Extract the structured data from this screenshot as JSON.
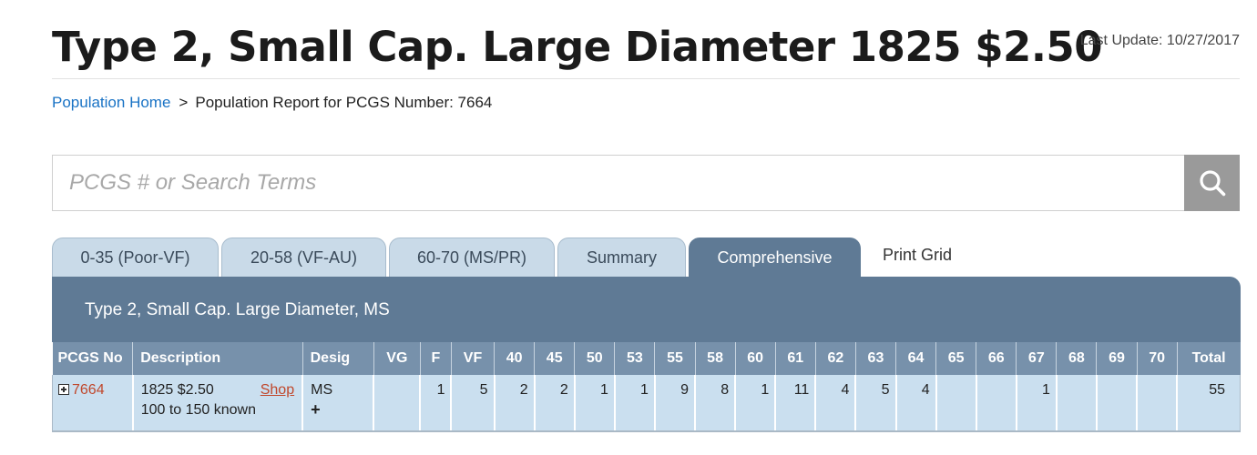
{
  "header": {
    "title": "Type 2, Small Cap. Large Diameter 1825 $2.50",
    "last_update": "Last Update: 10/27/2017"
  },
  "breadcrumb": {
    "home_label": "Population Home",
    "separator": ">",
    "current": "Population Report for PCGS Number: 7664"
  },
  "search": {
    "placeholder": "PCGS # or Search Terms",
    "value": "",
    "button_icon": "search-icon"
  },
  "tabs": [
    {
      "label": "0-35 (Poor-VF)",
      "active": false
    },
    {
      "label": "20-58 (VF-AU)",
      "active": false
    },
    {
      "label": "60-70 (MS/PR)",
      "active": false
    },
    {
      "label": "Summary",
      "active": false
    },
    {
      "label": "Comprehensive",
      "active": true
    },
    {
      "label": "Print Grid",
      "active": false
    }
  ],
  "panel": {
    "title": "Type 2, Small Cap. Large Diameter, MS"
  },
  "table": {
    "headers": [
      "PCGS No",
      "Description",
      "Desig",
      "VG",
      "F",
      "VF",
      "40",
      "45",
      "50",
      "53",
      "55",
      "58",
      "60",
      "61",
      "62",
      "63",
      "64",
      "65",
      "66",
      "67",
      "68",
      "69",
      "70",
      "Total"
    ],
    "rows": [
      {
        "pcgs_no": "7664",
        "description": "1825 $2.50",
        "known": "100 to 150 known",
        "shop_label": "Shop",
        "desig": "MS",
        "grades": [
          "",
          "1",
          "5",
          "2",
          "2",
          "1",
          "1",
          "9",
          "8",
          "1",
          "11",
          "4",
          "5",
          "4",
          "",
          "",
          "1",
          "",
          "",
          ""
        ],
        "total": "55"
      }
    ]
  },
  "colors": {
    "accent_link": "#1a73c5",
    "pcgs_link": "#c0472b",
    "panel_header": "#5f7a95",
    "table_header": "#7791ab",
    "row_background": "#cadfef",
    "tab_inactive": "#c9dae8",
    "search_button": "#9a9a9a"
  }
}
